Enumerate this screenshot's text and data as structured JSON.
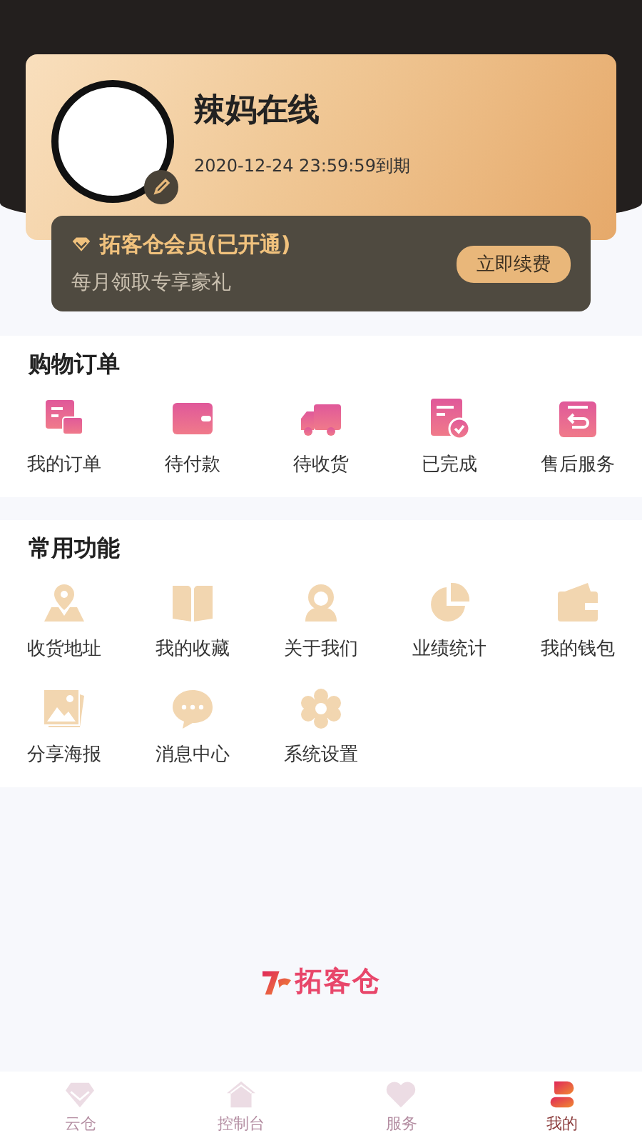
{
  "profile": {
    "name": "辣妈在线",
    "expiry": "2020-12-24 23:59:59到期"
  },
  "membership": {
    "title": "拓客仓会员(已开通)",
    "subtitle": "每月领取专享豪礼",
    "button": "立即续费"
  },
  "orders": {
    "title": "购物订单",
    "items": [
      "我的订单",
      "待付款",
      "待收货",
      "已完成",
      "售后服务"
    ]
  },
  "functions": {
    "title": "常用功能",
    "items": [
      "收货地址",
      "我的收藏",
      "关于我们",
      "业绩统计",
      "我的钱包",
      "分享海报",
      "消息中心",
      "系统设置"
    ]
  },
  "brand": {
    "name": "拓客仓"
  },
  "tabs": [
    {
      "label": "云仓",
      "selected": false
    },
    {
      "label": "控制台",
      "selected": false
    },
    {
      "label": "服务",
      "selected": false
    },
    {
      "label": "我的",
      "selected": true
    }
  ]
}
